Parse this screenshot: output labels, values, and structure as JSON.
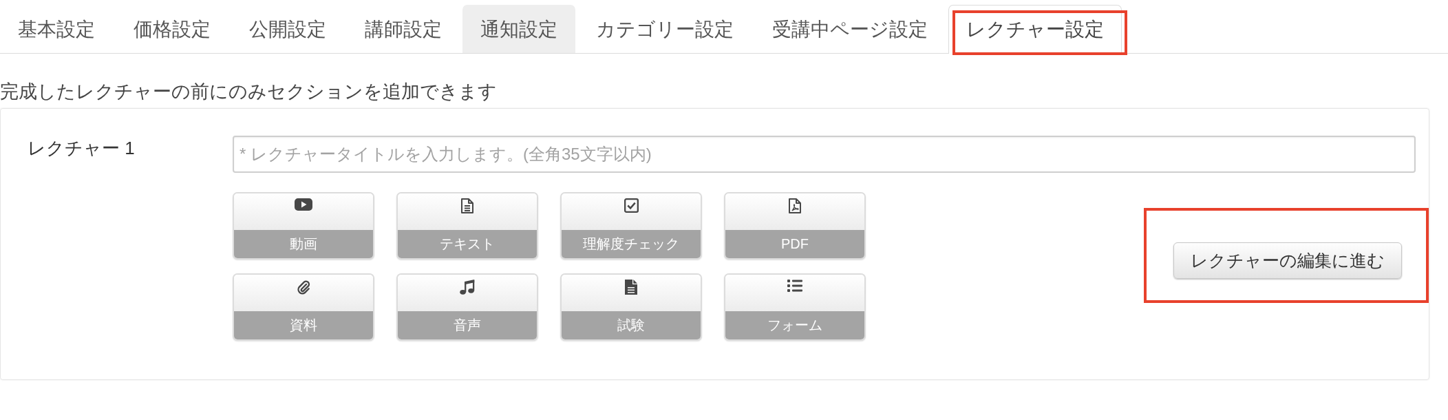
{
  "tabs": [
    {
      "label": "基本設定",
      "selected": false,
      "hovered": false,
      "highlighted": false
    },
    {
      "label": "価格設定",
      "selected": false,
      "hovered": false,
      "highlighted": false
    },
    {
      "label": "公開設定",
      "selected": false,
      "hovered": false,
      "highlighted": false
    },
    {
      "label": "講師設定",
      "selected": false,
      "hovered": false,
      "highlighted": false
    },
    {
      "label": "通知設定",
      "selected": false,
      "hovered": true,
      "highlighted": false
    },
    {
      "label": "カテゴリー設定",
      "selected": false,
      "hovered": false,
      "highlighted": false
    },
    {
      "label": "受講中ページ設定",
      "selected": false,
      "hovered": false,
      "highlighted": false
    },
    {
      "label": "レクチャー設定",
      "selected": true,
      "hovered": false,
      "highlighted": true
    }
  ],
  "notice": "完成したレクチャーの前にのみセクションを追加できます",
  "lecture": {
    "label": "レクチャー 1",
    "title_input": {
      "placeholder": "* レクチャータイトルを入力します。(全角35文字以内)"
    },
    "content_types": [
      {
        "kind": "video",
        "label": "動画"
      },
      {
        "kind": "text",
        "label": "テキスト"
      },
      {
        "kind": "quiz",
        "label": "理解度チェック"
      },
      {
        "kind": "pdf",
        "label": "PDF"
      },
      {
        "kind": "attachment",
        "label": "資料"
      },
      {
        "kind": "audio",
        "label": "音声"
      },
      {
        "kind": "exam",
        "label": "試験"
      },
      {
        "kind": "form",
        "label": "フォーム"
      }
    ],
    "edit_button": {
      "label": "レクチャーの編集に進む",
      "highlighted": true
    }
  }
}
